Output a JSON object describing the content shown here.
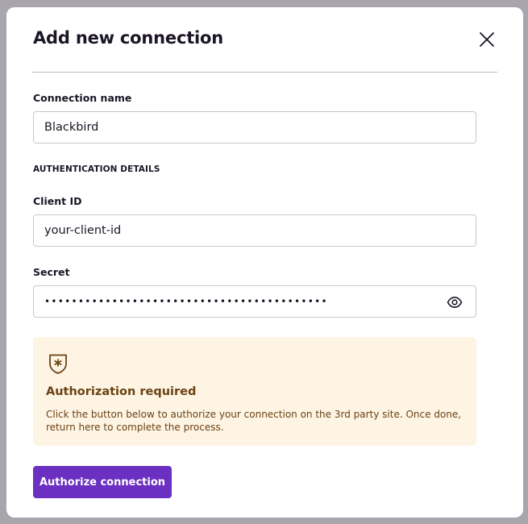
{
  "dialog": {
    "title": "Add new connection",
    "close_icon": "close-icon"
  },
  "connection_name": {
    "label": "Connection name",
    "value": "Blackbird"
  },
  "auth_section": {
    "heading": "AUTHENTICATION DETAILS"
  },
  "client_id": {
    "label": "Client ID",
    "value": "your-client-id"
  },
  "secret": {
    "label": "Secret",
    "value": "••••••••••••••••••••••••••••••••••••••••••",
    "toggle_icon": "eye-icon"
  },
  "callout": {
    "icon": "shield-star-icon",
    "title": "Authorization required",
    "body": "Click the button below to authorize your connection on the 3rd party site. Once done, return here to complete the process."
  },
  "actions": {
    "authorize_label": "Authorize connection"
  },
  "colors": {
    "accent": "#6b2fc2",
    "callout_bg": "#fef4e4",
    "callout_text": "#6a4213",
    "overlay": "#a9a5ac"
  }
}
